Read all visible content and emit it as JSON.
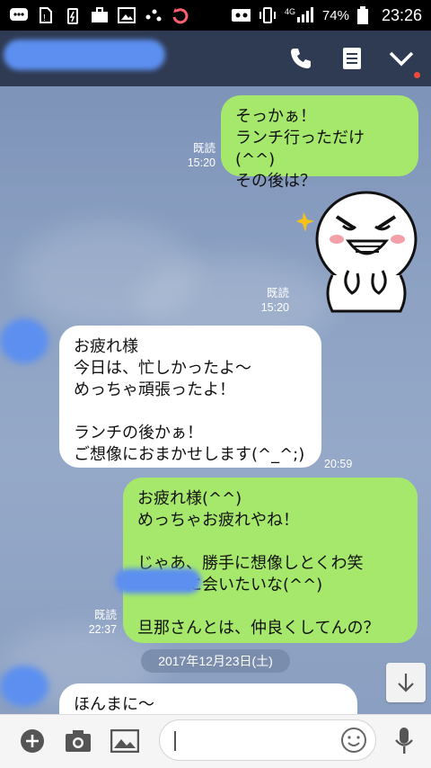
{
  "status_bar": {
    "signal_label": "4G",
    "battery_percent": "74%",
    "time": "23:26"
  },
  "header": {
    "contact_name": ""
  },
  "messages": [
    {
      "side": "mine",
      "text": "そっかぁ！\nランチ行っただけ(^^)\nその後は？",
      "read": "既読",
      "time": "15:20"
    },
    {
      "side": "mine",
      "type": "sticker",
      "read": "既読",
      "time": "15:20"
    },
    {
      "side": "theirs",
      "text": "お疲れ様\n今日は、忙しかったよ〜\nめっちゃ頑張ったよ！\n\nランチの後かぁ！\nご想像におまかせします(^_^;)",
      "time": "20:59"
    },
    {
      "side": "mine",
      "text": "お疲れ様(^^)\nめっちゃお疲れやね！\n\nじゃあ、勝手に想像しとくわ笑\n　　　に会いたいな(^^)\n\n旦那さんとは、仲良くしてんの？",
      "read": "既読",
      "time": "22:37"
    },
    {
      "side": "theirs",
      "text": "ほんまに〜"
    }
  ],
  "date_separator": "2017年12月23日(土)",
  "colors": {
    "my_bubble": "#a6e86c",
    "their_bubble": "#ffffff",
    "header": "#2f3b53",
    "chat_bg": "#8aa0c2"
  }
}
